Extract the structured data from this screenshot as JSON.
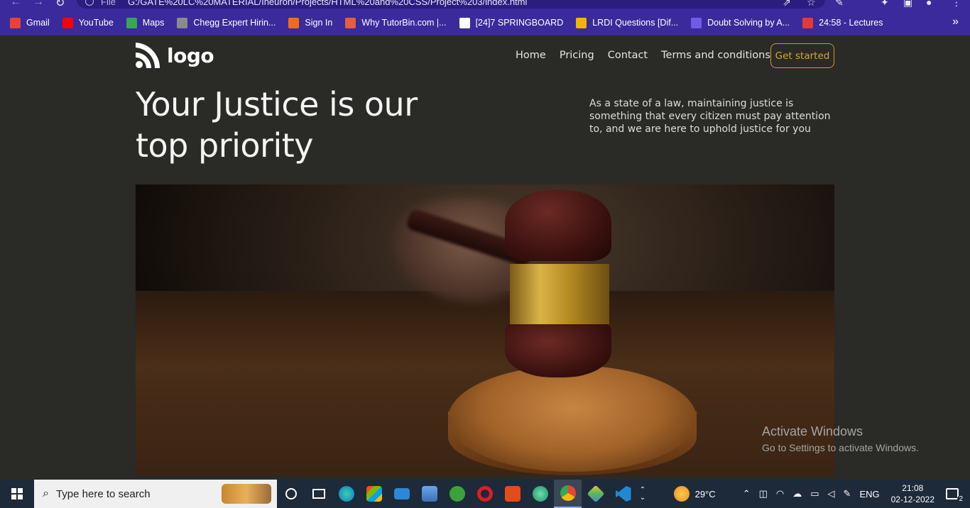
{
  "browser": {
    "url_prefix": "File",
    "url": "G:/GATE%20LC%20MATERIAL/Ineuron/Projects/HTML%20and%20CSS/Project%203/index.html",
    "bookmarks": [
      {
        "label": "Gmail",
        "color": "#ea4335"
      },
      {
        "label": "YouTube",
        "color": "#ff0000"
      },
      {
        "label": "Maps",
        "color": "#34a853"
      },
      {
        "label": "Chegg Expert Hirin...",
        "color": "#8a8a8a"
      },
      {
        "label": "Sign In",
        "color": "#f26b1d"
      },
      {
        "label": "Why TutorBin.com |...",
        "color": "#e85d3a"
      },
      {
        "label": "[24]7 SPRINGBOARD",
        "color": "#ffffff"
      },
      {
        "label": "LRDI Questions [Dif...",
        "color": "#f5b400"
      },
      {
        "label": "Doubt Solving by A...",
        "color": "#6f5ce6"
      },
      {
        "label": "24:58 - Lectures",
        "color": "#e53935"
      }
    ],
    "more": "»"
  },
  "site": {
    "logo_text": "logo",
    "nav": [
      "Home",
      "Pricing",
      "Contact",
      "Terms and conditions"
    ],
    "cta": "Get started",
    "hero_title": "Your Justice is our top priority",
    "hero_desc": "As a state of a law, maintaining justice is something that every citizen must pay attention to, and we are here to uphold justice for you",
    "accent_color": "#d7a535",
    "background": "#2a2a26"
  },
  "watermark": {
    "line1": "Activate Windows",
    "line2": "Go to Settings to activate Windows."
  },
  "taskbar": {
    "search_placeholder": "Type here to search",
    "temperature": "29°C",
    "language": "ENG",
    "time": "21:08",
    "date": "02-12-2022",
    "notifications": "2"
  }
}
